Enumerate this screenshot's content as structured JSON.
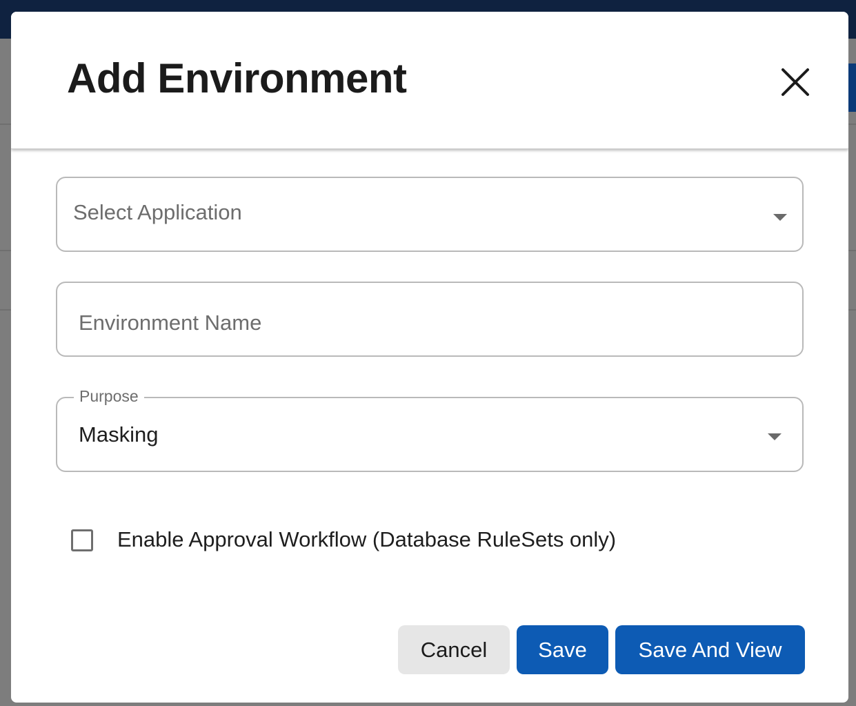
{
  "dialog": {
    "title": "Add Environment",
    "close_icon": "close-icon",
    "application_field": {
      "placeholder": "Select Application",
      "icon": "chevron-down-icon"
    },
    "environment_name_field": {
      "placeholder": "Environment Name"
    },
    "purpose_field": {
      "label": "Purpose",
      "value": "Masking",
      "icon": "chevron-down-icon"
    },
    "approval_checkbox": {
      "label": "Enable Approval Workflow (Database RuleSets only)",
      "checked": false
    },
    "buttons": {
      "cancel": "Cancel",
      "save": "Save",
      "save_and_view": "Save And View"
    }
  },
  "colors": {
    "primary": "#0d5bb4",
    "cancel_bg": "#e6e6e6",
    "overlay": "#7d7d7d",
    "topbar": "#0f2240"
  }
}
